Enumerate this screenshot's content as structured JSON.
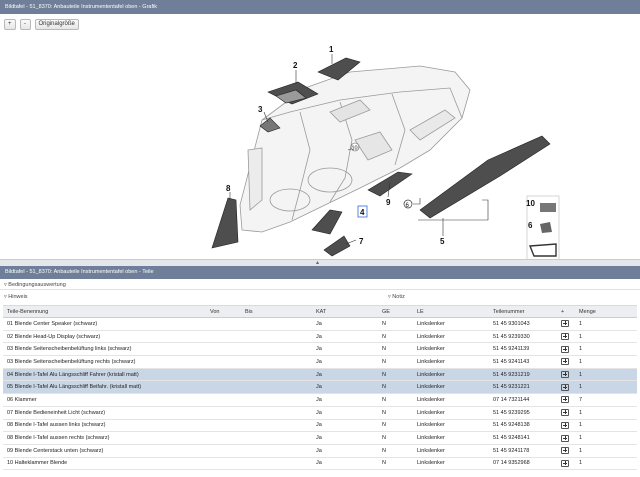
{
  "graphic_panel": {
    "title": "Bildtafel - 51_8370: Anbauteile Instrumententafel oben - Grafik",
    "toolbar": {
      "zoom_in": "+",
      "zoom_out": "-",
      "original_size": "Originalgröße"
    },
    "callouts": [
      "1",
      "2",
      "3",
      "4",
      "5",
      "6",
      "7",
      "8",
      "9",
      "10"
    ]
  },
  "parts_panel": {
    "title": "Bildtafel - 51_8370: Anbauteile Instrumententafel oben - Teile",
    "conditions": "Bedingungsauswertung",
    "notes_left": "Hinweis",
    "notes_right": "Notiz",
    "columns": [
      "Teile-Benennung",
      "Von",
      "Bis",
      "KAT",
      "GE",
      "LE",
      "Teilenummer",
      "+",
      "Menge"
    ],
    "rows": [
      {
        "name": "01 Blende Center Speaker (schwarz)",
        "kat": "Ja",
        "ge": "N",
        "le": "Linkslenker",
        "nr": "51 45 9301043",
        "qty": "1",
        "selected": false
      },
      {
        "name": "02 Blende Head-Up Display (schwarz)",
        "kat": "Ja",
        "ge": "N",
        "le": "Linkslenker",
        "nr": "51 45 9239330",
        "qty": "1",
        "selected": false
      },
      {
        "name": "03 Blende Seitenscheibenbelüftung links (schwarz)",
        "kat": "Ja",
        "ge": "N",
        "le": "Linkslenker",
        "nr": "51 45 9241139",
        "qty": "1",
        "selected": false
      },
      {
        "name": "03 Blende Seitenscheibenbelüftung rechts (schwarz)",
        "kat": "Ja",
        "ge": "N",
        "le": "Linkslenker",
        "nr": "51 45 9241143",
        "qty": "1",
        "selected": false
      },
      {
        "name": "04 Blende I-Tafel Alu Längsschliff Fahrer (kristall matt)",
        "kat": "Ja",
        "ge": "N",
        "le": "Linkslenker",
        "nr": "51 45 9231219",
        "qty": "1",
        "selected": true
      },
      {
        "name": "05 Blende I-Tafel Alu Längsschliff Beifahr. (kristall matt)",
        "kat": "Ja",
        "ge": "N",
        "le": "Linkslenker",
        "nr": "51 45 9231221",
        "qty": "1",
        "selected": true
      },
      {
        "name": "06 Klammer",
        "kat": "Ja",
        "ge": "N",
        "le": "Linkslenker",
        "nr": "07 14 7321144",
        "qty": "7",
        "selected": false
      },
      {
        "name": "07 Blende Bedieneinheit Licht (schwarz)",
        "kat": "Ja",
        "ge": "N",
        "le": "Linkslenker",
        "nr": "51 45 9239295",
        "qty": "1",
        "selected": false
      },
      {
        "name": "08 Blende I-Tafel aussen links (schwarz)",
        "kat": "Ja",
        "ge": "N",
        "le": "Linkslenker",
        "nr": "51 45 9248138",
        "qty": "1",
        "selected": false
      },
      {
        "name": "08 Blende I-Tafel aussen rechts (schwarz)",
        "kat": "Ja",
        "ge": "N",
        "le": "Linkslenker",
        "nr": "51 45 9248141",
        "qty": "1",
        "selected": false
      },
      {
        "name": "09 Blende Centerstack unten (schwarz)",
        "kat": "Ja",
        "ge": "N",
        "le": "Linkslenker",
        "nr": "51 45 9241178",
        "qty": "1",
        "selected": false
      },
      {
        "name": "10 Halteklammer Blende",
        "kat": "Ja",
        "ge": "N",
        "le": "Linkslenker",
        "nr": "07 14 9352968",
        "qty": "1",
        "selected": false
      }
    ]
  }
}
